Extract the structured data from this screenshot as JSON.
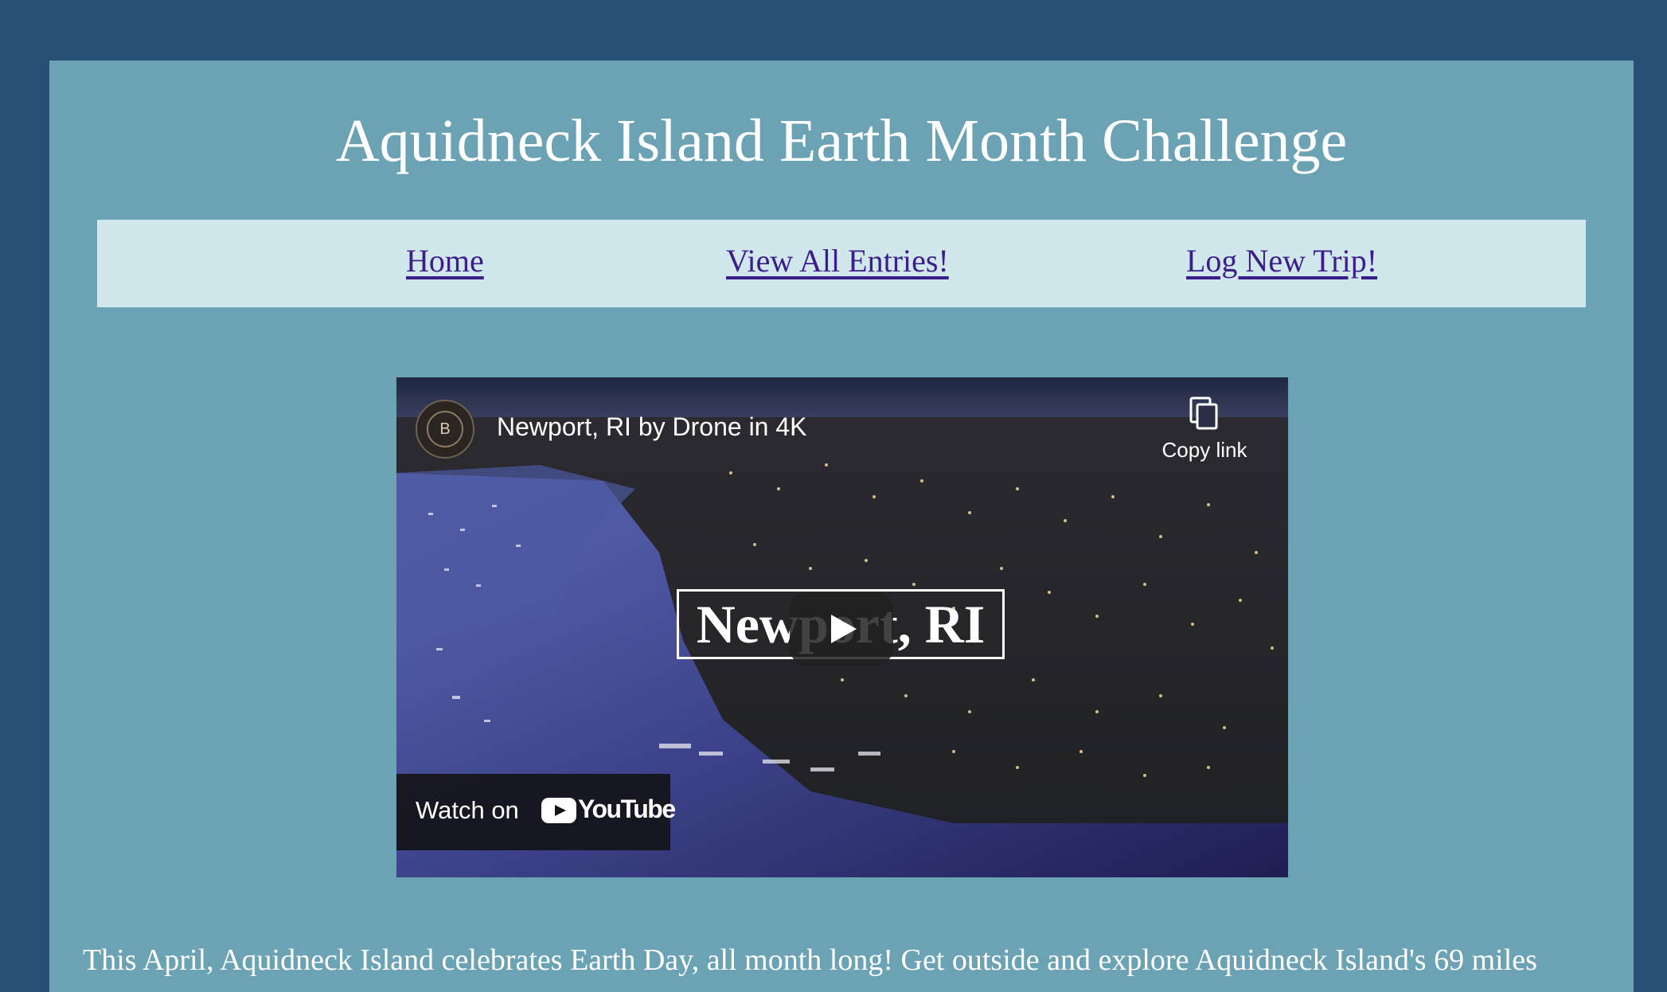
{
  "page": {
    "title": "Aquidneck Island Earth Month Challenge"
  },
  "nav": {
    "items": [
      {
        "label": "Home"
      },
      {
        "label": "View All Entries!"
      },
      {
        "label": "Log New Trip!"
      }
    ]
  },
  "video": {
    "title": "Newport, RI by Drone in 4K",
    "overlay_text": "Newport, RI",
    "channel_avatar_letter": "B",
    "copy_link_label": "Copy link",
    "watch_on_label": "Watch on",
    "platform_name": "YouTube"
  },
  "intro": {
    "text": "This April, Aquidneck Island celebrates Earth Day, all month long! Get outside and explore Aquidneck Island's 69 miles"
  },
  "colors": {
    "outer_background": "#264f73",
    "panel_background": "#6ba2b4",
    "nav_background": "#d0e7ec",
    "link_color": "#3c1d8c",
    "youtube_red": "#ff0000"
  }
}
